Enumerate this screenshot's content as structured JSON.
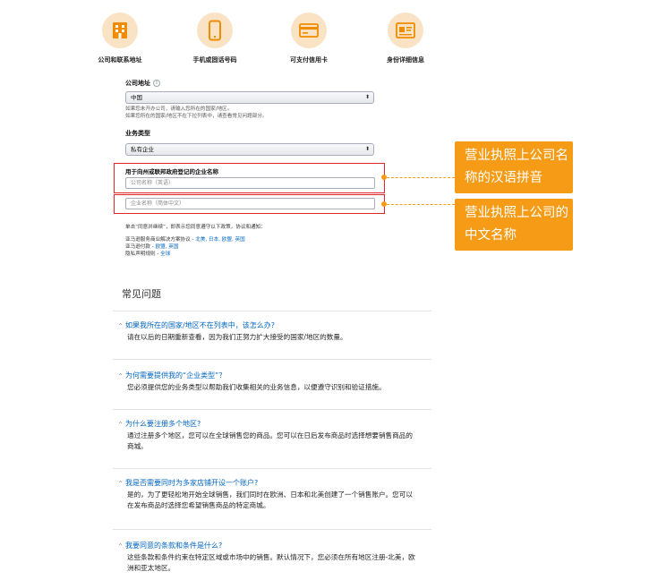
{
  "steps": [
    {
      "label": "公司和联系地址",
      "icon": "building-icon"
    },
    {
      "label": "手机或固话号码",
      "icon": "phone-icon"
    },
    {
      "label": "可支付信用卡",
      "icon": "credit-card-icon"
    },
    {
      "label": "身份详细信息",
      "icon": "id-card-icon"
    }
  ],
  "form": {
    "address_label": "公司地址",
    "country_value": "中国",
    "hint_line1": "如果您未开办公司，请输入您所在的国家/地区。",
    "hint_line2": "如果您所在的国家/地区不在下拉列表中，请查看常见问题部分。",
    "business_type_label": "业务类型",
    "business_type_value": "私有企业",
    "company_name_title": "用于向州或联邦政府登记的企业名称",
    "name_pinyin_placeholder": "公司名称（英语）",
    "name_chinese_placeholder": "企业名称（简体中文）",
    "agree_text": "单击“同意并继续”，即表示您同意遵守以下政策，协议和通知：",
    "policy1_prefix": "亚马逊服务商业解决方案协议 - ",
    "policy1_links": "北美, 日本, 欧盟, 英国",
    "policy2_prefix": "亚马逊付款 - ",
    "policy2_links": "欧盟, 英国",
    "policy3_prefix": "隐私声明规则 - ",
    "policy3_links": "全球"
  },
  "callouts": {
    "top": "营业执照上公司名称的汉语拼音",
    "bottom": "营业执照上公司的中文名称",
    "color": "#f59b16",
    "highlight_color": "#e0262a"
  },
  "faq": {
    "title": "常见问题",
    "items": [
      {
        "q": "如果我所在的国家/地区不在列表中，该怎么办?",
        "a": "请在以后的日期重新查看，因为我们正努力扩大接受的国家/地区的数量。"
      },
      {
        "q": "为何需要提供我的“企业类型”？",
        "a": "您必须提供您的业务类型以帮助我们收集相关的业务信息，以便遵守识别和验证措施。"
      },
      {
        "q": "为什么要注册多个地区?",
        "a": "通过注册多个地区，您可以在全球销售您的商品。您可以在日后发布商品时选择想要销售商品的商城。"
      },
      {
        "q": "我是否需要同时为多家店铺开设一个账户?",
        "a": "是的，为了更轻松地开始全球销售，我们同时在欧洲、日本和北美创建了一个销售账户。您可以在发布商品时选择您希望销售商品的特定商城。"
      },
      {
        "q": "我要同意的条款和条件是什么?",
        "a": "这些条款和条件约束在特定区域或市场中的销售。默认情况下，您必须在所有地区注册-北美，欧洲和亚太地区。"
      }
    ]
  }
}
